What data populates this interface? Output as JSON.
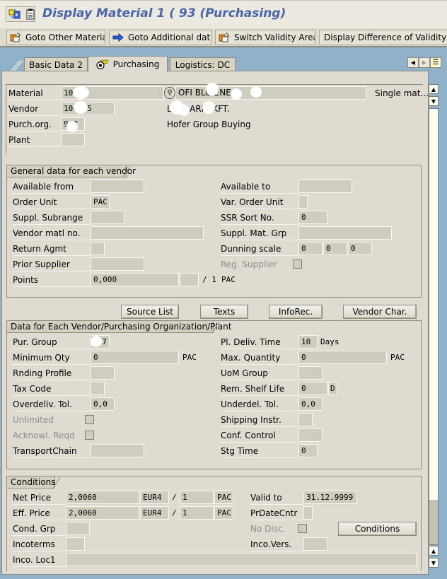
{
  "window": {
    "title": "Display Material 1  (  93 (Purchasing)",
    "icons": [
      "mode-switch-icon",
      "clipboard-icon"
    ]
  },
  "toolbar": {
    "buttons": [
      {
        "label": "Goto Other Material",
        "icon": "other-object-icon"
      },
      {
        "label": "Goto Additional data",
        "icon": "arrow-right-icon"
      },
      {
        "label": "Switch Validity Area",
        "icon": "switch-area-icon"
      },
      {
        "label": "Display Difference of Validity Area",
        "icon": ""
      }
    ]
  },
  "tabs": {
    "items": [
      {
        "label": "Basic Data 2",
        "active": false
      },
      {
        "label": "Purchasing",
        "active": true,
        "icon": "purchasing-icon"
      },
      {
        "label": "Logistics: DC",
        "active": false
      }
    ],
    "nav": [
      "tab-scroll-left-icon",
      "tab-scroll-right-icon",
      "tab-list-icon"
    ]
  },
  "header": {
    "material_label": "Material",
    "material_value": "10",
    "material_desc": "OFI BLU ENE  4",
    "material_type": "Single mat…",
    "vendor_label": "Vendor",
    "vendor_value": "100  25",
    "vendor_name": "L   HU  ARIA KFT.",
    "purch_org_label": "Purch.org.",
    "purch_org_value": "9  8",
    "purch_org_name": "Hofer Group Buying",
    "plant_label": "Plant",
    "plant_value": ""
  },
  "general": {
    "title": "General data for each vendor",
    "available_from": {
      "label": "Available from",
      "value": ""
    },
    "available_to": {
      "label": "Available to",
      "value": ""
    },
    "order_unit": {
      "label": "Order Unit",
      "value": "PAC"
    },
    "var_order_unit": {
      "label": "Var. Order Unit",
      "value": ""
    },
    "suppl_subrange": {
      "label": "Suppl. Subrange",
      "value": ""
    },
    "ssr_sort_no": {
      "label": "SSR Sort No.",
      "value": "0"
    },
    "vendor_matl_no": {
      "label": "Vendor matl no.",
      "value": ""
    },
    "suppl_mat_grp": {
      "label": "Suppl. Mat. Grp",
      "value": ""
    },
    "return_agmt": {
      "label": "Return Agmt",
      "value": ""
    },
    "dunning_scale": {
      "label": "Dunning scale",
      "values": [
        "0",
        "0",
        "0"
      ]
    },
    "prior_supplier": {
      "label": "Prior Supplier",
      "value": ""
    },
    "reg_supplier": {
      "label": "Reg. Supplier",
      "checked": false
    },
    "points": {
      "label": "Points",
      "value": "0,000",
      "unit_field": "",
      "per": "/ 1",
      "unit": "PAC"
    }
  },
  "buttons": {
    "source_list": "Source List",
    "texts": "Texts",
    "inforec": "InfoRec.",
    "vendor_char": "Vendor Char."
  },
  "org": {
    "title": "Data for Each Vendor/Purchasing Organization/Plant",
    "pur_group": {
      "label": "Pur. Group",
      "value": "7"
    },
    "pl_deliv_time": {
      "label": "Pl. Deliv. Time",
      "value": "10",
      "unit": "Days"
    },
    "minimum_qty": {
      "label": "Minimum Qty",
      "value": "0",
      "unit": "PAC"
    },
    "max_quantity": {
      "label": "Max. Quantity",
      "value": "0",
      "unit": "PAC"
    },
    "rnding_profile": {
      "label": "Rnding Profile",
      "value": ""
    },
    "uom_group": {
      "label": "UoM Group",
      "value": ""
    },
    "tax_code": {
      "label": "Tax Code",
      "value": ""
    },
    "rem_shelf_life": {
      "label": "Rem. Shelf Life",
      "value": "0",
      "unit": "D"
    },
    "overdeliv_tol": {
      "label": "Overdeliv. Tol.",
      "value": "0,0"
    },
    "underdel_tol": {
      "label": "Underdel. Tol.",
      "value": "0,0"
    },
    "unlimited": {
      "label": "Unlimited",
      "checked": false
    },
    "shipping_instr": {
      "label": "Shipping Instr.",
      "value": ""
    },
    "acknowl_reqd": {
      "label": "Acknowl. Reqd",
      "checked": false
    },
    "conf_control": {
      "label": "Conf. Control",
      "value": ""
    },
    "transport_chain": {
      "label": "TransportChain",
      "value": ""
    },
    "stg_time": {
      "label": "Stg Time",
      "value": "0"
    }
  },
  "conditions": {
    "title": "Conditions",
    "net_price": {
      "label": "Net Price",
      "value": "2,0060",
      "currency": "EUR4",
      "per": "1",
      "unit": "PAC"
    },
    "eff_price": {
      "label": "Eff. Price",
      "value": "2,0060",
      "currency": "EUR4",
      "per": "1",
      "unit": "PAC"
    },
    "slash": "/",
    "valid_to": {
      "label": "Valid to",
      "value": "31.12.9999"
    },
    "pr_date_cntr": {
      "label": "PrDateCntr",
      "value": ""
    },
    "cond_grp": {
      "label": "Cond. Grp",
      "value": ""
    },
    "no_disc": {
      "label": "No Disc.",
      "checked": false
    },
    "conditions_button": "Conditions",
    "incoterms": {
      "label": "Incoterms",
      "value": ""
    },
    "inco_vers": {
      "label": "Inco.Vers.",
      "value": ""
    },
    "inco_loc1": {
      "label": "Inco. Loc1",
      "value": ""
    }
  },
  "scrollbar": {
    "position": 0,
    "visible_fraction": 0.9
  }
}
